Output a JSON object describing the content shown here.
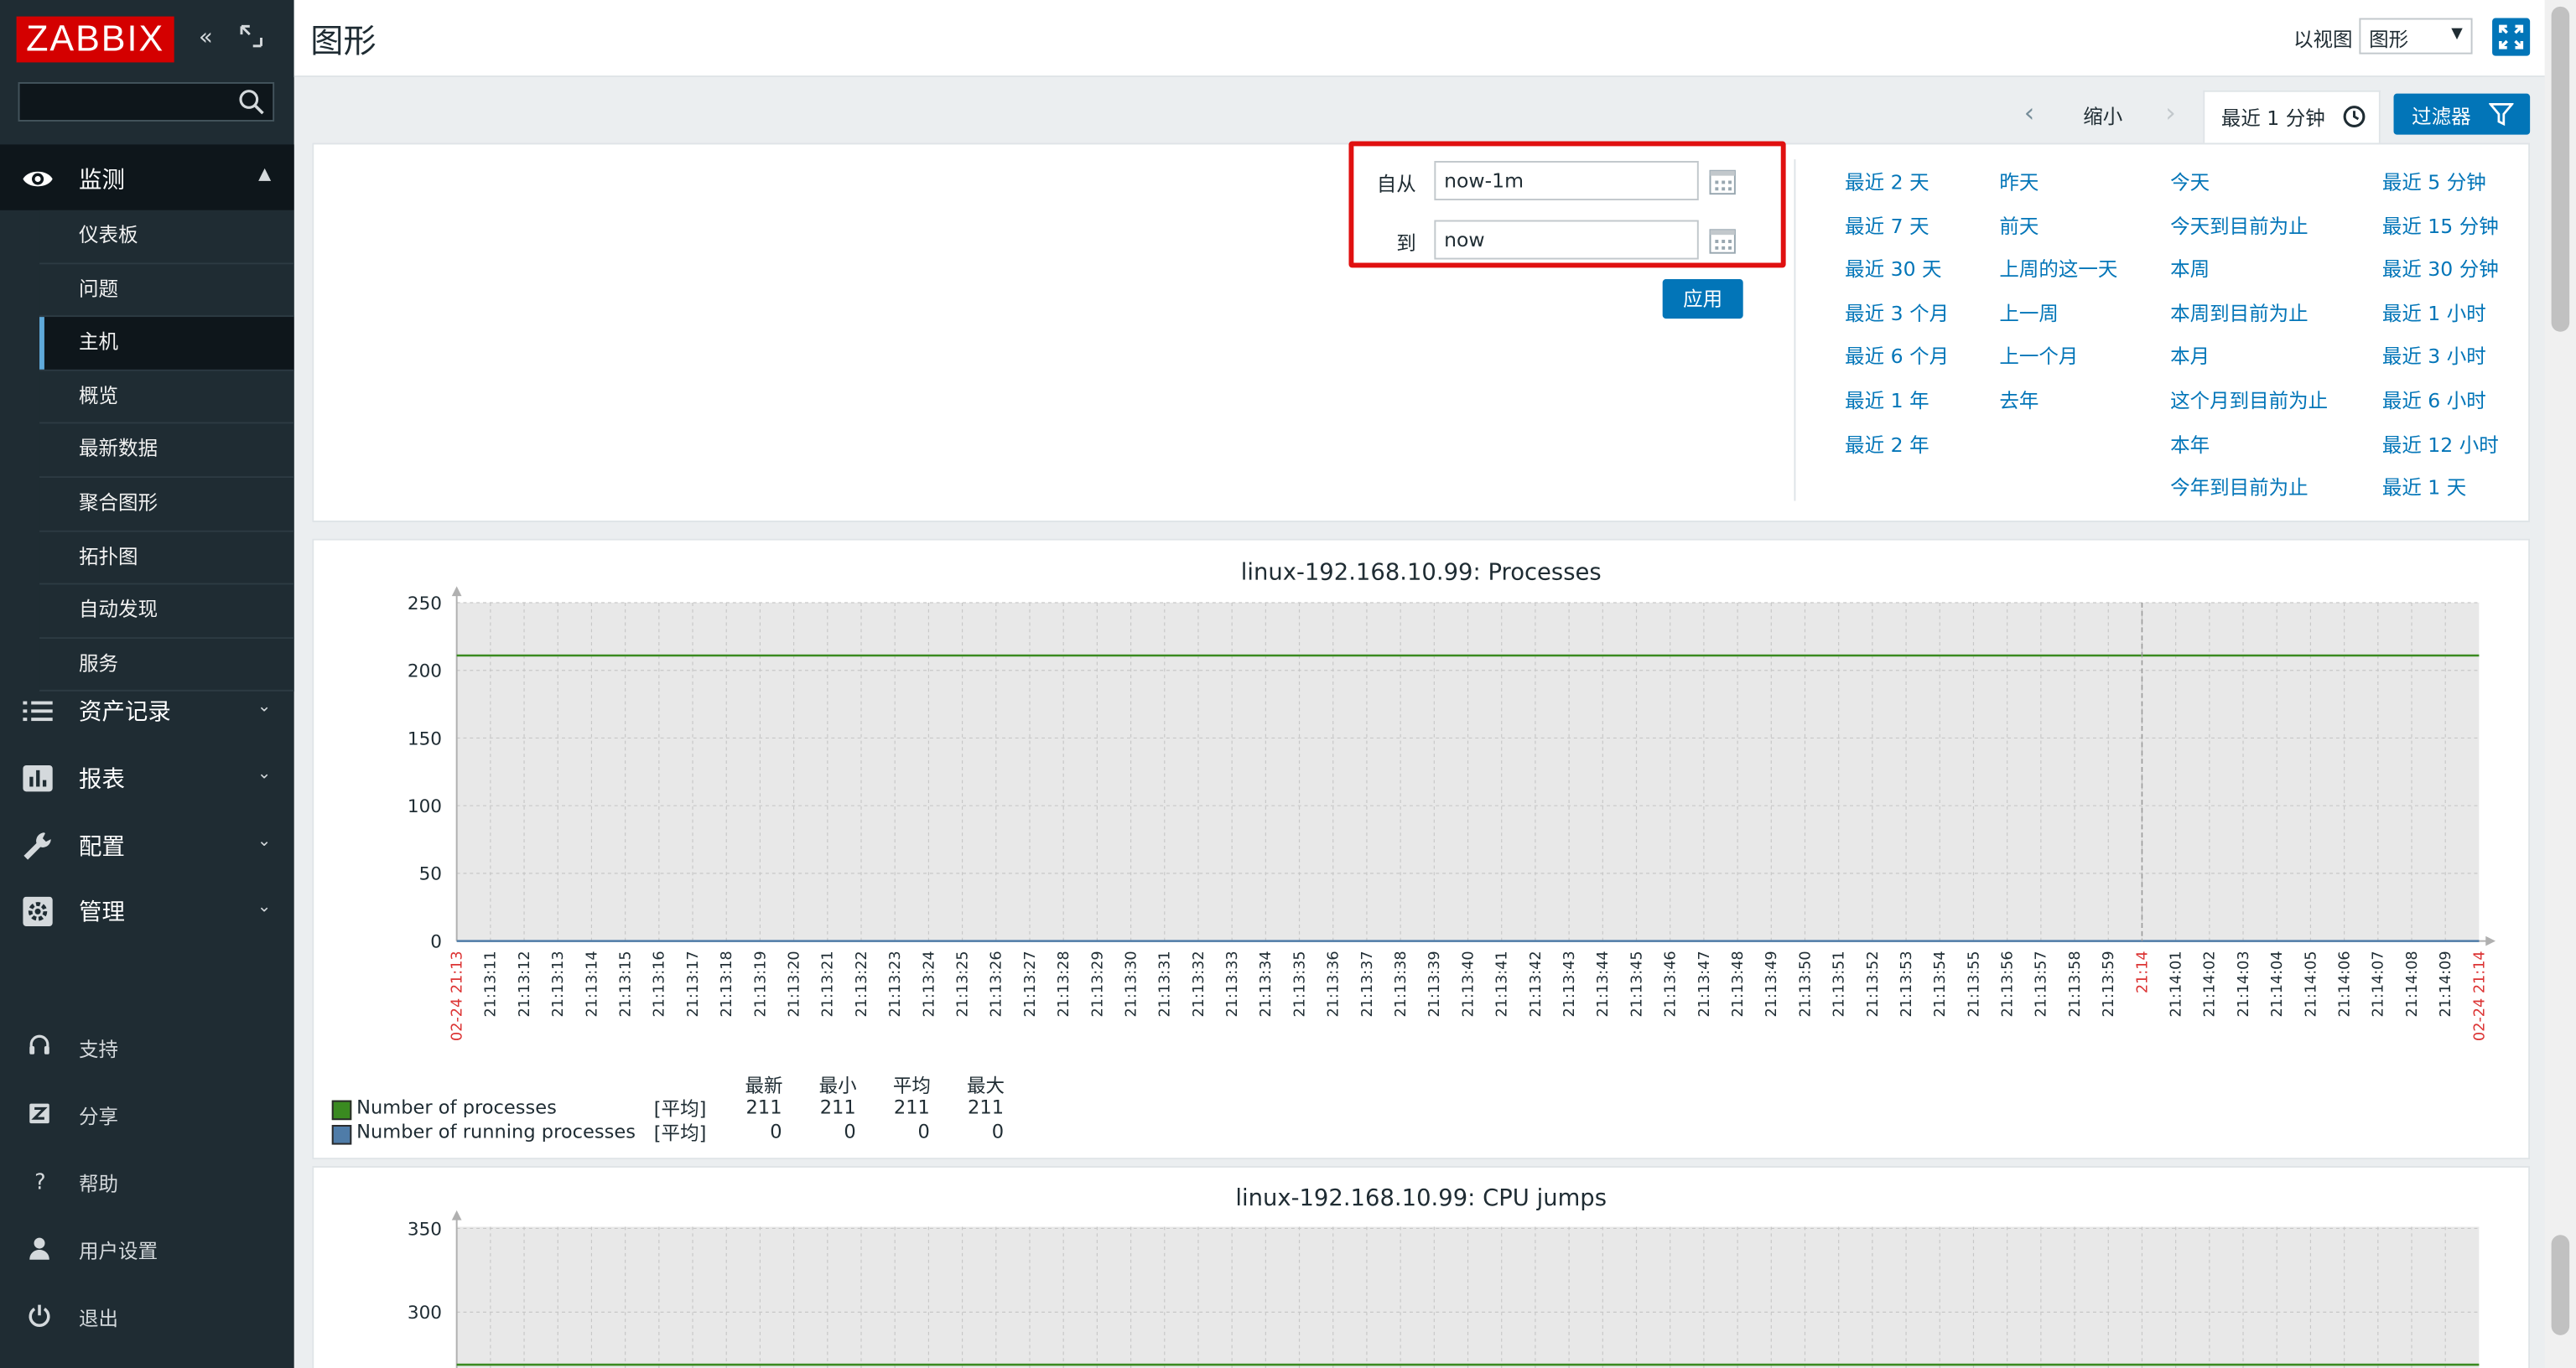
{
  "app": {
    "logo": "ZABBIX"
  },
  "header": {
    "title": "图形",
    "view_label": "以视图",
    "view_value": "图形"
  },
  "sidebar": {
    "monitor": {
      "label": "监测",
      "items": [
        "仪表板",
        "问题",
        "主机",
        "概览",
        "最新数据",
        "聚合图形",
        "拓扑图",
        "自动发现",
        "服务"
      ],
      "active_index": 2
    },
    "menus": [
      {
        "label": "资产记录"
      },
      {
        "label": "报表"
      },
      {
        "label": "配置"
      },
      {
        "label": "管理"
      }
    ],
    "bottom": [
      {
        "label": "支持"
      },
      {
        "label": "分享"
      },
      {
        "label": "帮助"
      },
      {
        "label": "用户设置"
      },
      {
        "label": "退出"
      }
    ]
  },
  "timeline": {
    "zoom_out": "缩小",
    "recent": "最近 1 分钟",
    "filter": "过滤器"
  },
  "filter": {
    "from_label": "自从",
    "from_value": "now-1m",
    "to_label": "到",
    "to_value": "now",
    "apply": "应用",
    "quick_links": [
      [
        "最近 2 天",
        "最近 7 天",
        "最近 30 天",
        "最近 3 个月",
        "最近 6 个月",
        "最近 1 年",
        "最近 2 年"
      ],
      [
        "昨天",
        "前天",
        "上周的这一天",
        "上一周",
        "上一个月",
        "去年"
      ],
      [
        "今天",
        "今天到目前为止",
        "本周",
        "本周到目前为止",
        "本月",
        "这个月到目前为止",
        "本年",
        "今年到目前为止"
      ],
      [
        "最近 5 分钟",
        "最近 15 分钟",
        "最近 30 分钟",
        "最近 1 小时",
        "最近 3 小时",
        "最近 6 小时",
        "最近 12 小时",
        "最近 1 天"
      ]
    ]
  },
  "graphs": [
    {
      "title": "linux-192.168.10.99: Processes"
    },
    {
      "title": "linux-192.168.10.99: CPU jumps"
    }
  ],
  "chart_data": [
    {
      "type": "line",
      "title": "linux-192.168.10.99: Processes",
      "ylim": [
        0,
        250
      ],
      "yticks": [
        0,
        50,
        100,
        150,
        200,
        250
      ],
      "x_start": "02-24 21:13",
      "x_mid": "21:14",
      "x_end": "02-24 21:14",
      "x_ticks_before": [
        "21:13:11",
        "21:13:12",
        "21:13:13",
        "21:13:14",
        "21:13:15",
        "21:13:16",
        "21:13:17",
        "21:13:18",
        "21:13:19",
        "21:13:20",
        "21:13:21",
        "21:13:22",
        "21:13:23",
        "21:13:24",
        "21:13:25",
        "21:13:26",
        "21:13:27",
        "21:13:28",
        "21:13:29",
        "21:13:30",
        "21:13:31",
        "21:13:32",
        "21:13:33",
        "21:13:34",
        "21:13:35",
        "21:13:36",
        "21:13:37",
        "21:13:38",
        "21:13:39",
        "21:13:40",
        "21:13:41",
        "21:13:42",
        "21:13:43",
        "21:13:44",
        "21:13:45",
        "21:13:46",
        "21:13:47",
        "21:13:48",
        "21:13:49",
        "21:13:50",
        "21:13:51",
        "21:13:52",
        "21:13:53",
        "21:13:54",
        "21:13:55",
        "21:13:56",
        "21:13:57",
        "21:13:58",
        "21:13:59"
      ],
      "x_ticks_after": [
        "21:14:01",
        "21:14:02",
        "21:14:03",
        "21:14:04",
        "21:14:05",
        "21:14:06",
        "21:14:07",
        "21:14:08",
        "21:14:09"
      ],
      "series": [
        {
          "name": "Number of processes",
          "color": "#3a8a20",
          "values": [
            211,
            211
          ]
        },
        {
          "name": "Number of running processes",
          "color": "#4f7ca8",
          "values": [
            0,
            0
          ]
        }
      ],
      "legend": {
        "headers": [
          "最新",
          "最小",
          "平均",
          "最大"
        ],
        "rows": [
          {
            "name": "Number of processes",
            "func": "[平均]",
            "last": "211",
            "min": "211",
            "avg": "211",
            "max": "211",
            "color": "#3a8a20"
          },
          {
            "name": "Number of running processes",
            "func": "[平均]",
            "last": "0",
            "min": "0",
            "avg": "0",
            "max": "0",
            "color": "#4f7ca8"
          }
        ]
      }
    },
    {
      "type": "line",
      "title": "linux-192.168.10.99: CPU jumps",
      "yticks": [
        300,
        350
      ],
      "series": [
        {
          "color": "#3a8a20"
        }
      ]
    }
  ]
}
